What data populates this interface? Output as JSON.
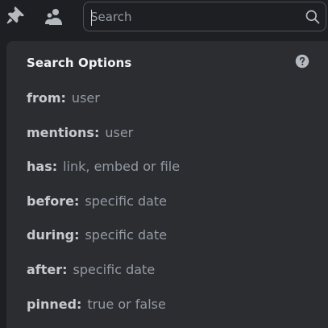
{
  "toolbar": {
    "pin_icon": "pin-icon",
    "members_icon": "members-icon"
  },
  "search": {
    "placeholder": "Search",
    "value": "",
    "icon": "search-icon"
  },
  "popout": {
    "title": "Search Options",
    "help_icon": "help-icon",
    "options": [
      {
        "key": "from:",
        "value": "user"
      },
      {
        "key": "mentions:",
        "value": "user"
      },
      {
        "key": "has:",
        "value": "link, embed or file"
      },
      {
        "key": "before:",
        "value": "specific date"
      },
      {
        "key": "during:",
        "value": "specific date"
      },
      {
        "key": "after:",
        "value": "specific date"
      },
      {
        "key": "pinned:",
        "value": "true or false"
      }
    ]
  },
  "colors": {
    "background": "#1e1f22",
    "popout": "#2b2d31",
    "title": "#f2f3f5",
    "key_text": "#c6c9ce",
    "value_text": "#949ba4",
    "icon": "#b5bac1",
    "border": "#4e5058"
  }
}
